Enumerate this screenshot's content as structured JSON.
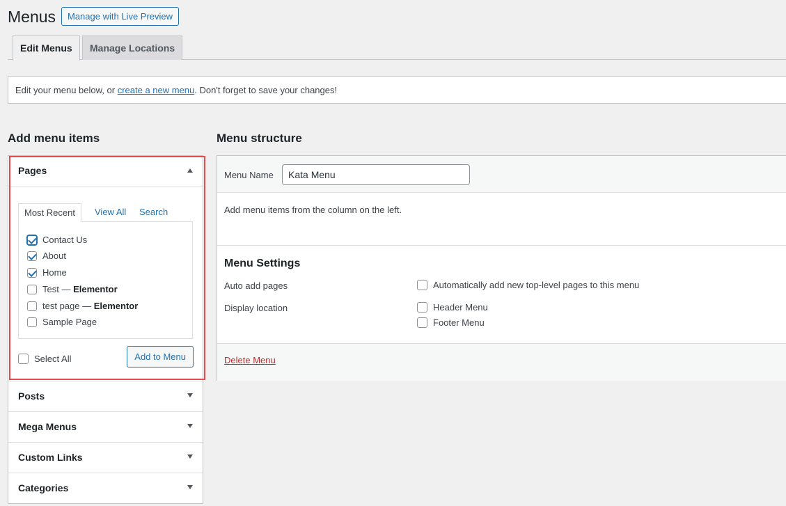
{
  "header": {
    "title": "Menus",
    "live_preview_label": "Manage with Live Preview"
  },
  "tabs": [
    {
      "label": "Edit Menus",
      "active": true
    },
    {
      "label": "Manage Locations",
      "active": false
    }
  ],
  "notice": {
    "before": "Edit your menu below, or ",
    "link": "create a new menu",
    "after": ". Don't forget to save your changes!"
  },
  "left": {
    "title": "Add menu items",
    "pages": {
      "title": "Pages",
      "tabs": [
        "Most Recent",
        "View All",
        "Search"
      ],
      "items": [
        {
          "label": "Contact Us",
          "suffix": "",
          "checked": true
        },
        {
          "label": "About",
          "suffix": "",
          "checked": true
        },
        {
          "label": "Home",
          "suffix": "",
          "checked": true
        },
        {
          "label": "Test — ",
          "suffix": "Elementor",
          "checked": false
        },
        {
          "label": "test page — ",
          "suffix": "Elementor",
          "checked": false
        },
        {
          "label": "Sample Page",
          "suffix": "",
          "checked": false
        }
      ],
      "select_all": "Select All",
      "add_button": "Add to Menu"
    },
    "sections": [
      "Posts",
      "Mega Menus",
      "Custom Links",
      "Categories"
    ]
  },
  "right": {
    "title": "Menu structure",
    "menu_name_label": "Menu Name",
    "menu_name_value": "Kata Menu",
    "instructions": "Add menu items from the column on the left.",
    "settings_title": "Menu Settings",
    "auto_add_label": "Auto add pages",
    "auto_add_option": "Automatically add new top-level pages to this menu",
    "display_location_label": "Display location",
    "locations": [
      "Header Menu",
      "Footer Menu"
    ],
    "delete_label": "Delete Menu"
  },
  "colors": {
    "accent": "#2271b1",
    "highlight": "#e74c4c",
    "delete": "#b32d2e"
  }
}
